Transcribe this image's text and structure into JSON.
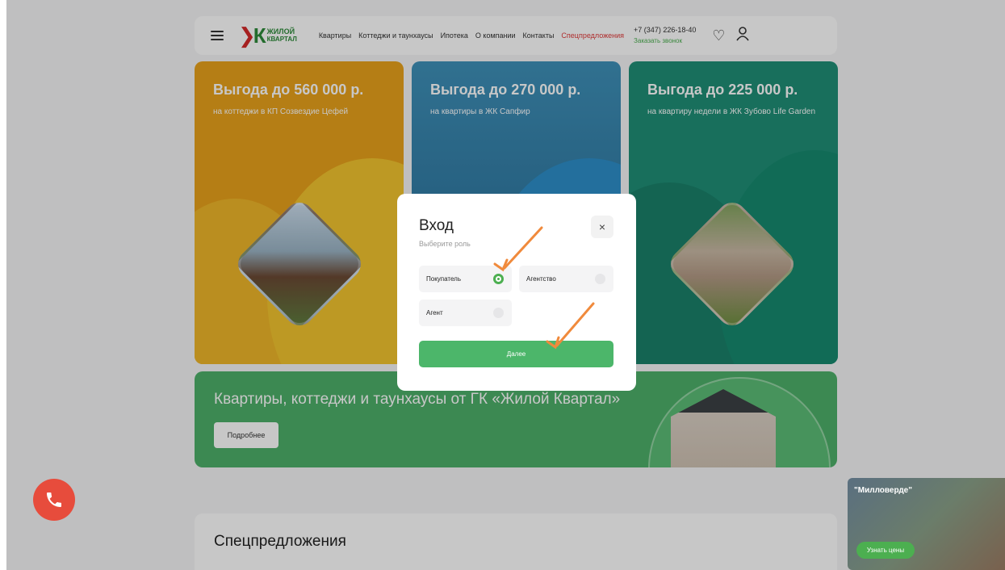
{
  "header": {
    "logo_line1": "ЖИЛОЙ",
    "logo_line2": "КВАРТАЛ",
    "nav": [
      "Квартиры",
      "Коттеджи и таунхаусы",
      "Ипотека",
      "О компании",
      "Контакты",
      "Спецпредложения"
    ],
    "phone": "+7 (347) 226-18-40",
    "callback": "Заказать звонок"
  },
  "cards": [
    {
      "title": "Выгода до 560 000 р.",
      "subtitle": "на коттеджи в КП Созвездие Цефей"
    },
    {
      "title": "Выгода до 270 000 р.",
      "subtitle": "на квартиры в ЖК Сапфир"
    },
    {
      "title": "Выгода до 225 000 р.",
      "subtitle": "на квартиру недели в ЖК Зубово Life Garden"
    }
  ],
  "banner": {
    "title": "Квартиры, коттеджи и таунхаусы от ГК «Жилой Квартал»",
    "button": "Подробнее"
  },
  "specials": {
    "title": "Спецпредложения"
  },
  "modal": {
    "title": "Вход",
    "subtitle": "Выберите роль",
    "close": "×",
    "roles": [
      {
        "label": "Покупатель",
        "selected": true
      },
      {
        "label": "Агентство",
        "selected": false
      },
      {
        "label": "Агент",
        "selected": false
      }
    ],
    "next": "Далее"
  },
  "promo": {
    "name": "\"Милловерде\"",
    "button": "Узнать цены"
  },
  "colors": {
    "accent_green": "#4cb66a",
    "accent_red": "#e03a3a",
    "arrow": "#f08a3c"
  }
}
